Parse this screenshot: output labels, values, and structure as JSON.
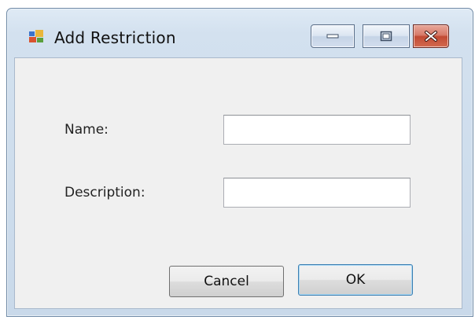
{
  "window": {
    "title": "Add Restriction",
    "icon": "application-icon",
    "controls": [
      "minimize-icon",
      "maximize-icon",
      "close-icon"
    ],
    "close_color": "#c14a33"
  },
  "form": {
    "name_label": "Name:",
    "name_value": "",
    "description_label": "Description:",
    "description_value": ""
  },
  "buttons": {
    "cancel_label": "Cancel",
    "ok_label": "OK"
  }
}
